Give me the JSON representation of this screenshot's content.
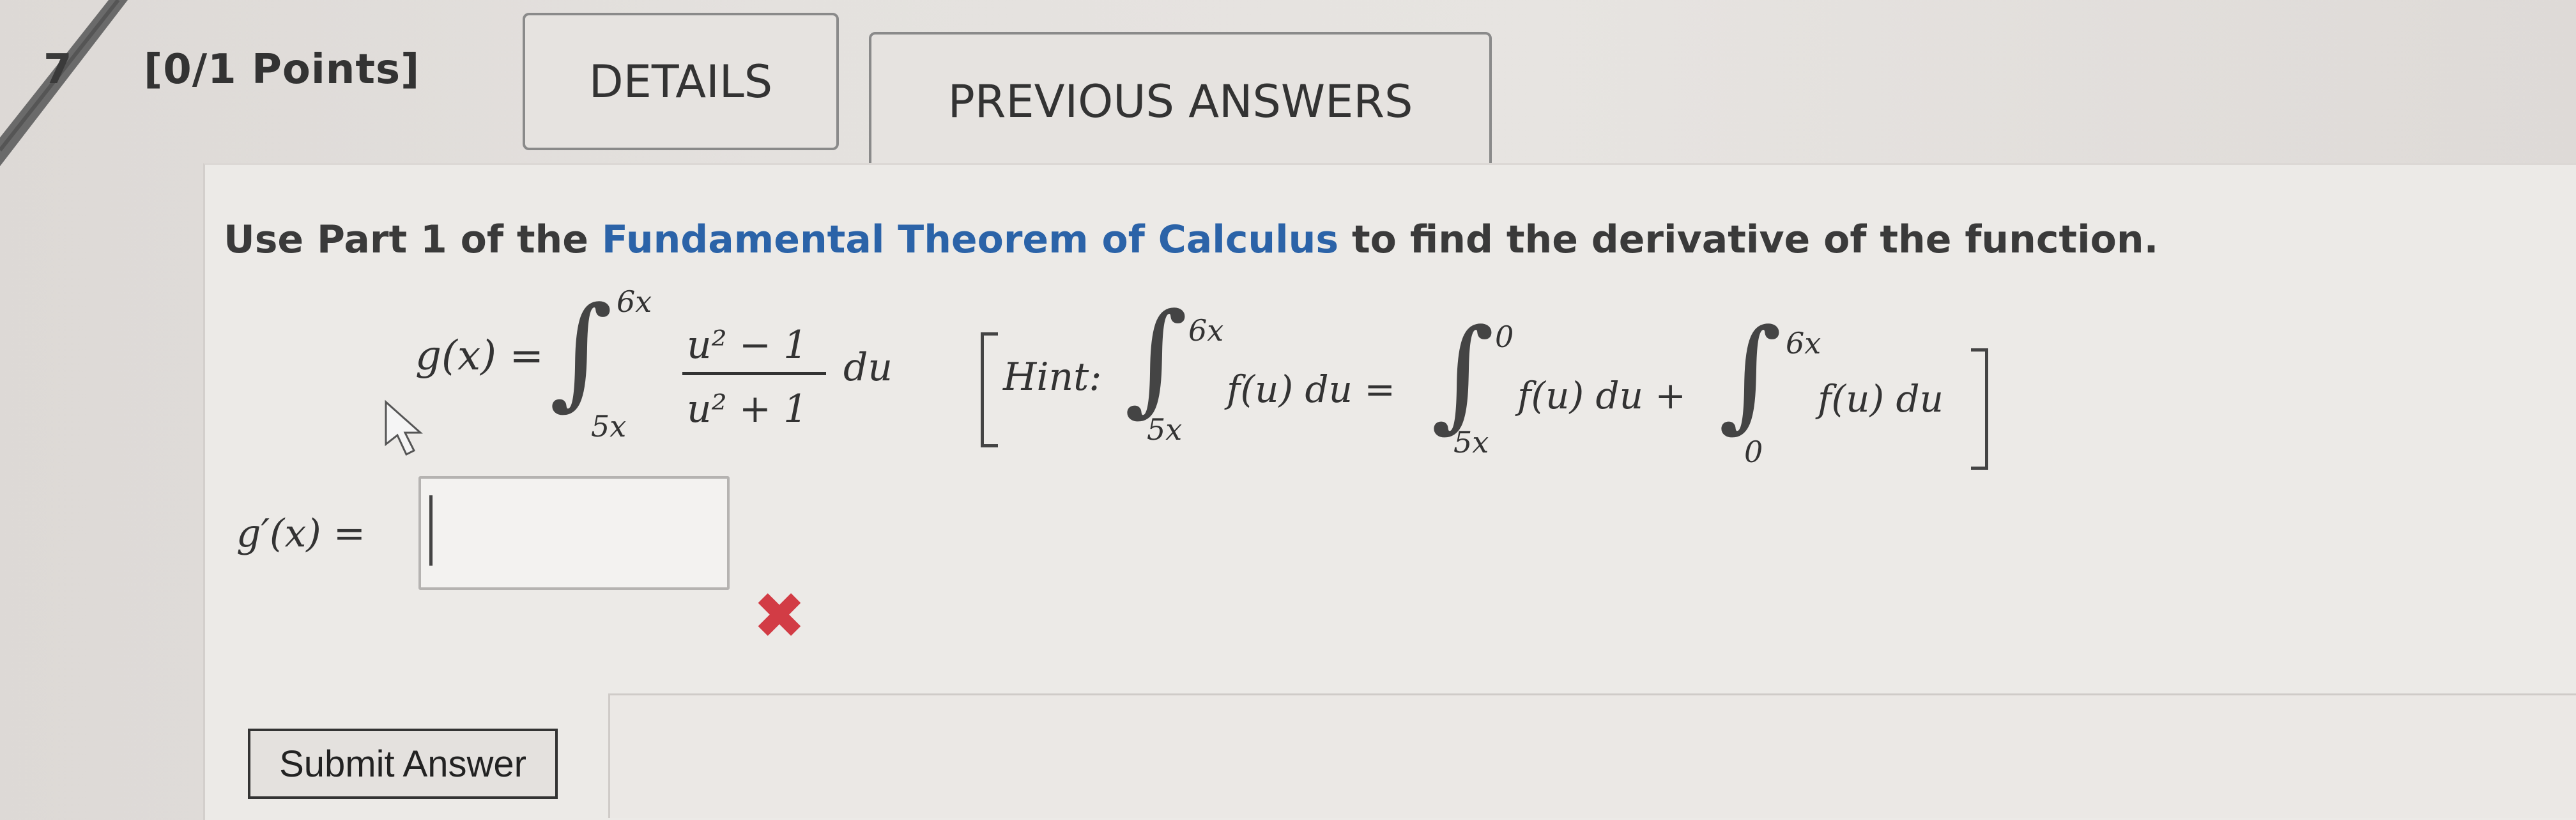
{
  "question": {
    "number": "7",
    "points": "[0/1 Points]",
    "details_label": "DETAILS",
    "previous_answers_label": "PREVIOUS ANSWERS"
  },
  "instruction": {
    "before": "Use Part 1 of the ",
    "link": "Fundamental Theorem of Calculus",
    "after": " to find the derivative of the function."
  },
  "function": {
    "lhs": "g(x) =",
    "upper": "6x",
    "lower": "5x",
    "numerator": "u² − 1",
    "denominator": "u² + 1",
    "du": "du"
  },
  "hint": {
    "label": "Hint:",
    "int1_upper": "6x",
    "int1_lower": "5x",
    "int1_body": "f(u) du =",
    "int2_upper": "0",
    "int2_lower": "5x",
    "int2_body": "f(u) du +",
    "int3_upper": "6x",
    "int3_lower": "0",
    "int3_body": "f(u) du"
  },
  "answer": {
    "label": "g′(x) =",
    "value": "",
    "status_icon": "x-mark-icon",
    "status_color": "#d23c45"
  },
  "submit_label": "Submit Answer",
  "colors": {
    "link": "#2b63a8"
  }
}
